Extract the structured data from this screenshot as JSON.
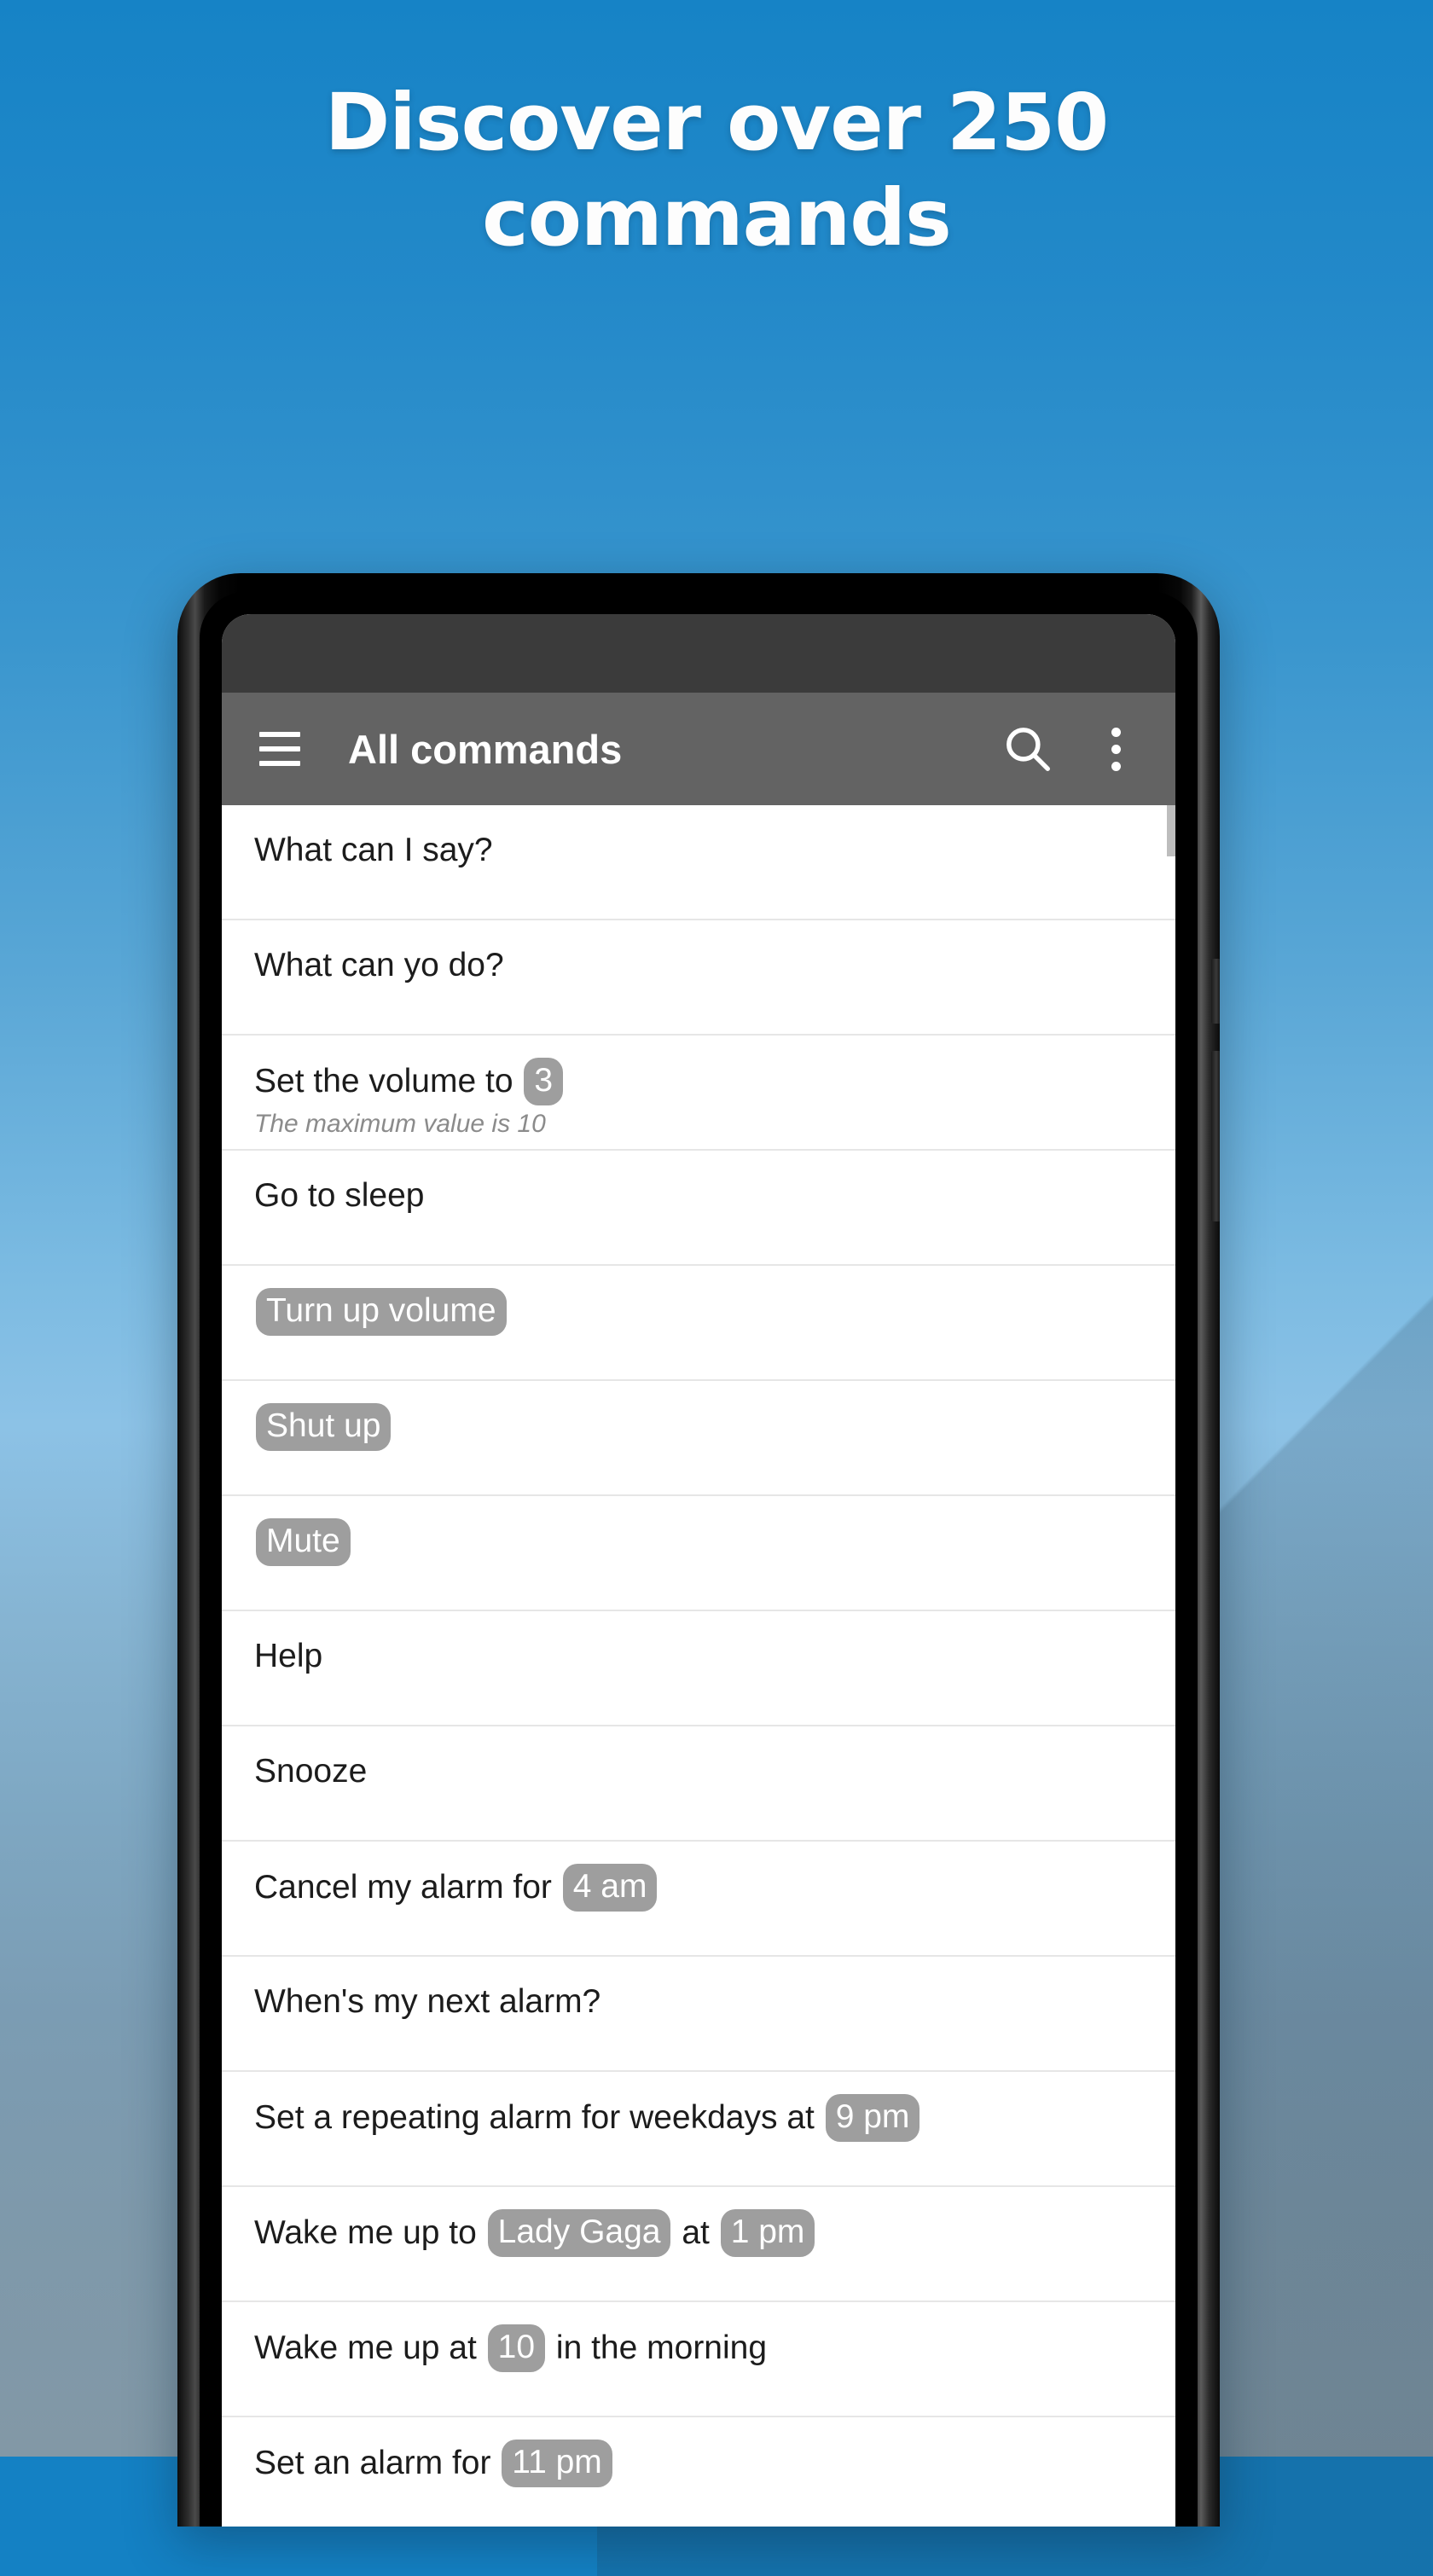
{
  "headline": {
    "line1": "Discover over 250",
    "line2": "commands"
  },
  "colors": {
    "background_top": "#1683c6",
    "background_bottom": "#8298a6",
    "appbar": "#636363",
    "statusbar": "#3b3b3b",
    "chip": "#9e9e9e",
    "divider": "#e6e6e6",
    "title_text": "#ffffff",
    "row_text": "#1c1c1c",
    "subtitle_text": "#8b8b8b"
  },
  "appbar": {
    "title": "All commands",
    "menu_icon": "hamburger-menu-icon",
    "search_icon": "search-icon",
    "overflow_icon": "more-vertical-icon"
  },
  "list": {
    "rows": [
      {
        "parts": [
          {
            "t": "text",
            "v": "Set an alarm for "
          },
          {
            "t": "chip",
            "v": "11 pm"
          }
        ]
      },
      {
        "parts": [
          {
            "t": "text",
            "v": "Wake me up at "
          },
          {
            "t": "chip",
            "v": "10"
          },
          {
            "t": "text",
            "v": " in the morning"
          }
        ]
      },
      {
        "parts": [
          {
            "t": "text",
            "v": "Wake me up to "
          },
          {
            "t": "chip",
            "v": "Lady Gaga"
          },
          {
            "t": "text",
            "v": " at "
          },
          {
            "t": "chip",
            "v": "1 pm"
          }
        ]
      },
      {
        "parts": [
          {
            "t": "text",
            "v": "Set a repeating alarm for weekdays at "
          },
          {
            "t": "chip",
            "v": "9 pm"
          }
        ]
      },
      {
        "parts": [
          {
            "t": "text",
            "v": "When's my next alarm?"
          }
        ]
      },
      {
        "parts": [
          {
            "t": "text",
            "v": "Cancel my alarm for "
          },
          {
            "t": "chip",
            "v": "4 am"
          }
        ]
      },
      {
        "parts": [
          {
            "t": "text",
            "v": "Snooze"
          }
        ]
      },
      {
        "parts": [
          {
            "t": "text",
            "v": "Help"
          }
        ]
      },
      {
        "parts": [
          {
            "t": "chip",
            "v": "Mute"
          }
        ]
      },
      {
        "parts": [
          {
            "t": "chip",
            "v": "Shut up"
          }
        ]
      },
      {
        "parts": [
          {
            "t": "chip",
            "v": "Turn up volume"
          }
        ]
      },
      {
        "parts": [
          {
            "t": "text",
            "v": "Go to sleep"
          }
        ]
      },
      {
        "parts": [
          {
            "t": "text",
            "v": "Set the volume to "
          },
          {
            "t": "chip",
            "v": "3"
          }
        ],
        "subtitle": "The maximum value is 10"
      },
      {
        "parts": [
          {
            "t": "text",
            "v": "What can yo do?"
          }
        ]
      },
      {
        "parts": [
          {
            "t": "text",
            "v": "What can I say?"
          }
        ]
      }
    ]
  }
}
